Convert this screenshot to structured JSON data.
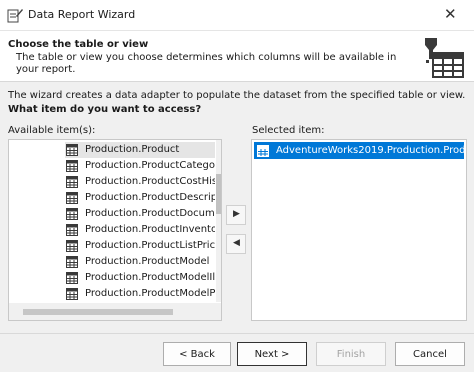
{
  "window": {
    "title": "Data Report Wizard",
    "close_glyph": "✕"
  },
  "header": {
    "title": "Choose the table or view",
    "description": "The table or view you choose determines which columns will be available in your report.",
    "icon": "table-wizard-icon"
  },
  "intro": "The wizard creates a data adapter to populate the dataset from the specified table or view.",
  "question": "What item do you want to access?",
  "available": {
    "label": "Available item(s):",
    "items": [
      "Production.Product",
      "Production.ProductCatego",
      "Production.ProductCostHis",
      "Production.ProductDescrip",
      "Production.ProductDocume",
      "Production.ProductInvento",
      "Production.ProductListPric",
      "Production.ProductModel",
      "Production.ProductModelIll",
      "Production.ProductModelP"
    ],
    "highlighted_index": 0
  },
  "transfer": {
    "add_glyph": "▶",
    "remove_glyph": "◀"
  },
  "selected": {
    "label": "Selected item:",
    "items": [
      "AdventureWorks2019.Production.Produc"
    ]
  },
  "buttons": {
    "back": "< Back",
    "next": "Next >",
    "finish": "Finish",
    "cancel": "Cancel"
  },
  "colors": {
    "selection": "#0078d7",
    "hover": "#e5e5e5"
  }
}
